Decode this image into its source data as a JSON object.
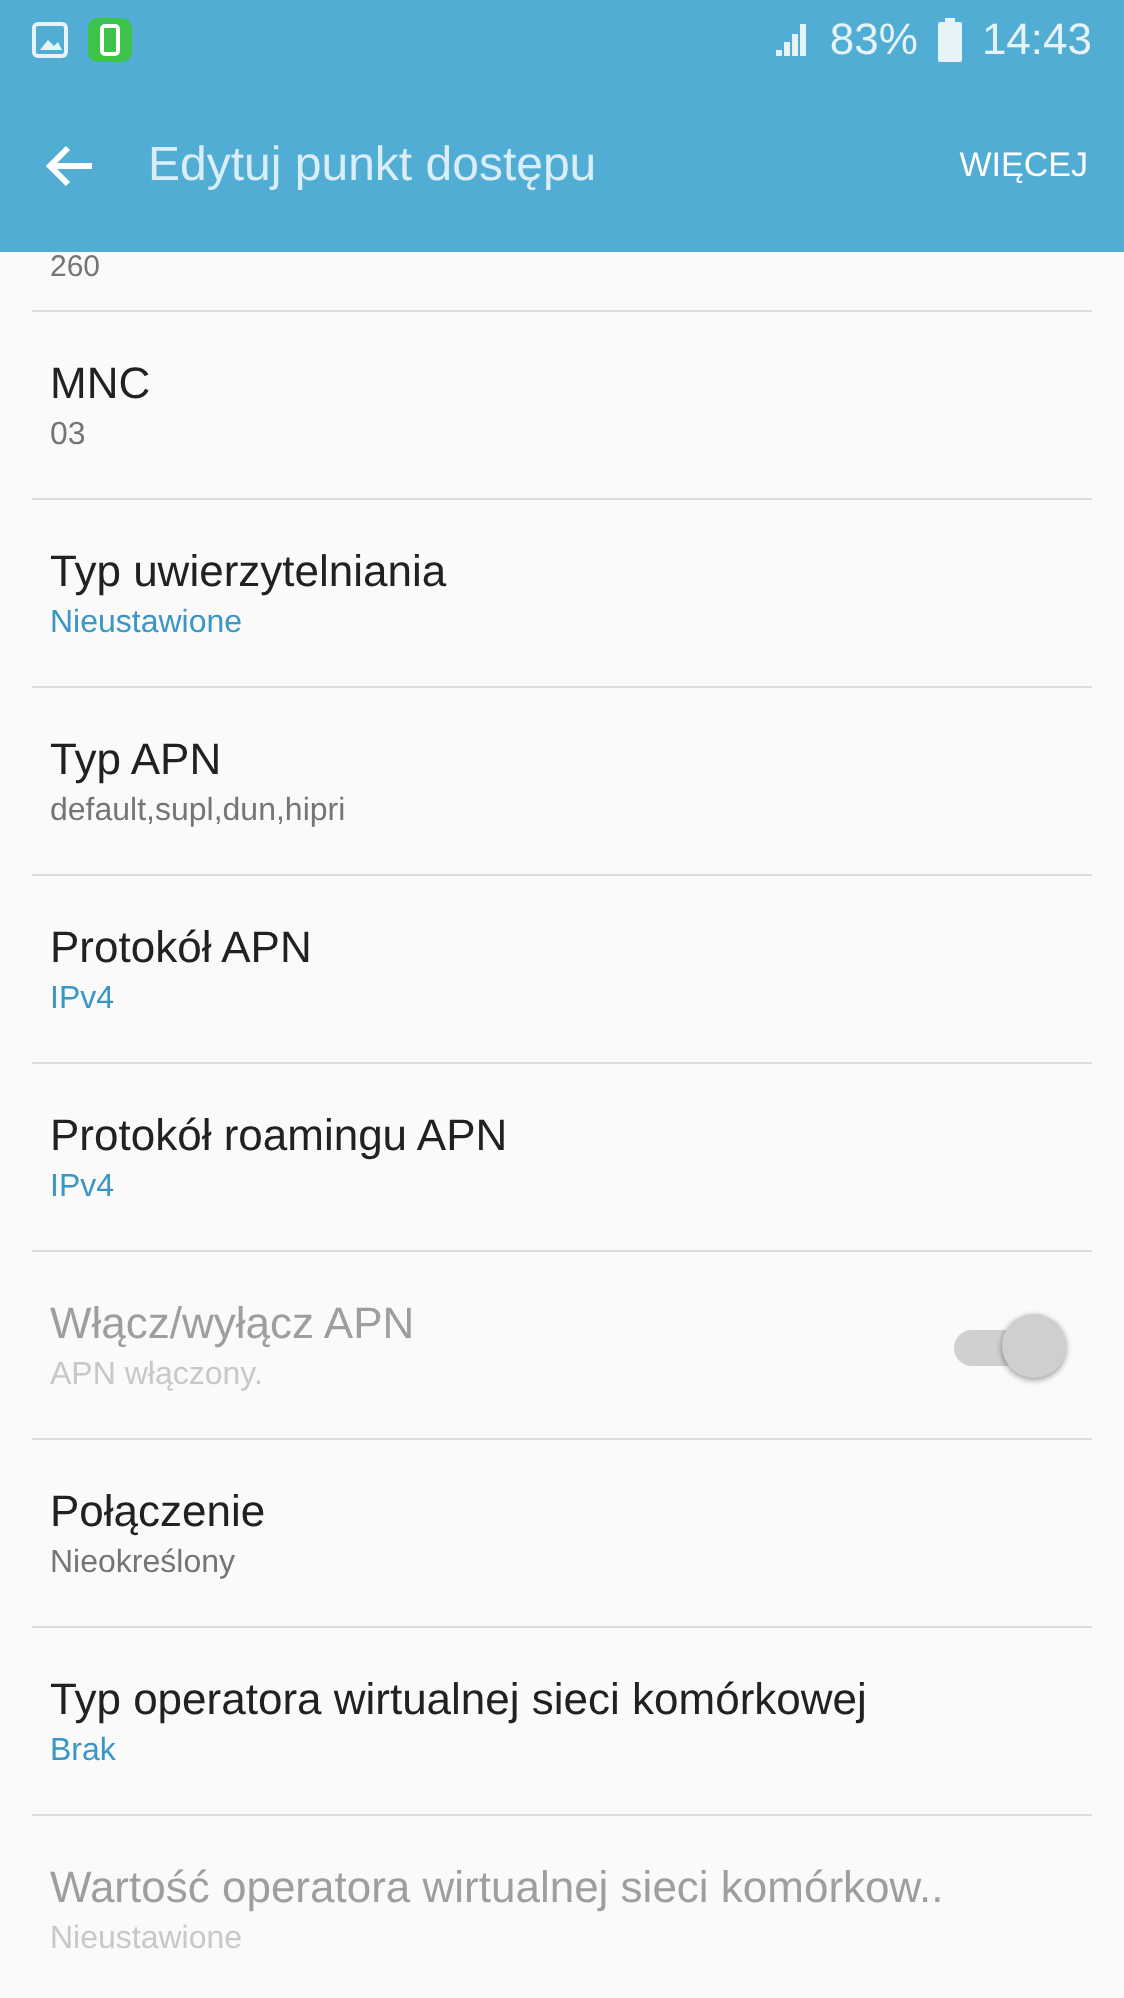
{
  "status_bar": {
    "battery": "83%",
    "time": "14:43"
  },
  "toolbar": {
    "title": "Edytuj punkt dostępu",
    "more": "WIĘCEJ"
  },
  "partial_item": {
    "value": "260"
  },
  "items": [
    {
      "kind": "text",
      "title": "MNC",
      "value": "03",
      "accent": false,
      "disabled": false
    },
    {
      "kind": "text",
      "title": "Typ uwierzytelniania",
      "value": "Nieustawione",
      "accent": true,
      "disabled": false
    },
    {
      "kind": "text",
      "title": "Typ APN",
      "value": "default,supl,dun,hipri",
      "accent": false,
      "disabled": false
    },
    {
      "kind": "text",
      "title": "Protokół APN",
      "value": "IPv4",
      "accent": true,
      "disabled": false
    },
    {
      "kind": "text",
      "title": "Protokół roamingu APN",
      "value": "IPv4",
      "accent": true,
      "disabled": false
    },
    {
      "kind": "switch",
      "title": "Włącz/wyłącz APN",
      "value": "APN włączony.",
      "accent": false,
      "disabled": true,
      "on": true
    },
    {
      "kind": "text",
      "title": "Połączenie",
      "value": "Nieokreślony",
      "accent": false,
      "disabled": false
    },
    {
      "kind": "text",
      "title": "Typ operatora wirtualnej sieci komórkowej",
      "value": "Brak",
      "accent": true,
      "disabled": false
    },
    {
      "kind": "text",
      "title": "Wartość operatora wirtualnej sieci komórkow..",
      "value": "Nieustawione",
      "accent": false,
      "disabled": true
    }
  ]
}
